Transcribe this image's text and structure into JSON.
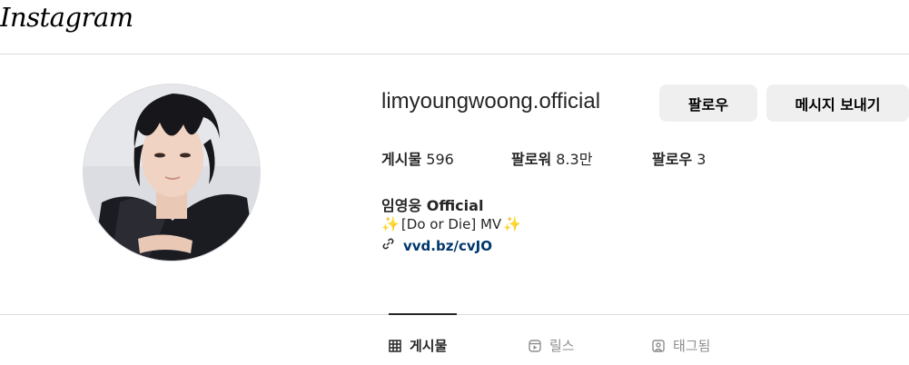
{
  "header": {
    "logo_text": "Instagram"
  },
  "profile": {
    "username": "limyoungwoong.official",
    "buttons": {
      "follow": "팔로우",
      "message": "메시지 보내기"
    },
    "stats": [
      {
        "label": "게시물",
        "value": "596"
      },
      {
        "label": "팔로워",
        "value": "8.3만"
      },
      {
        "label": "팔로우",
        "value": "3"
      }
    ],
    "full_name": "임영웅 Official",
    "bio": "[Do or Die] MV",
    "link": "vvd.bz/cvJO"
  },
  "tabs": [
    {
      "label": "게시물",
      "icon": "grid-icon",
      "active": true
    },
    {
      "label": "릴스",
      "icon": "reels-icon",
      "active": false
    },
    {
      "label": "태그됨",
      "icon": "tagged-icon",
      "active": false
    }
  ],
  "colors": {
    "link": "#00376b",
    "button_bg": "#efefef",
    "divider": "#dbdbdb",
    "sparkle": "#e8b600"
  }
}
